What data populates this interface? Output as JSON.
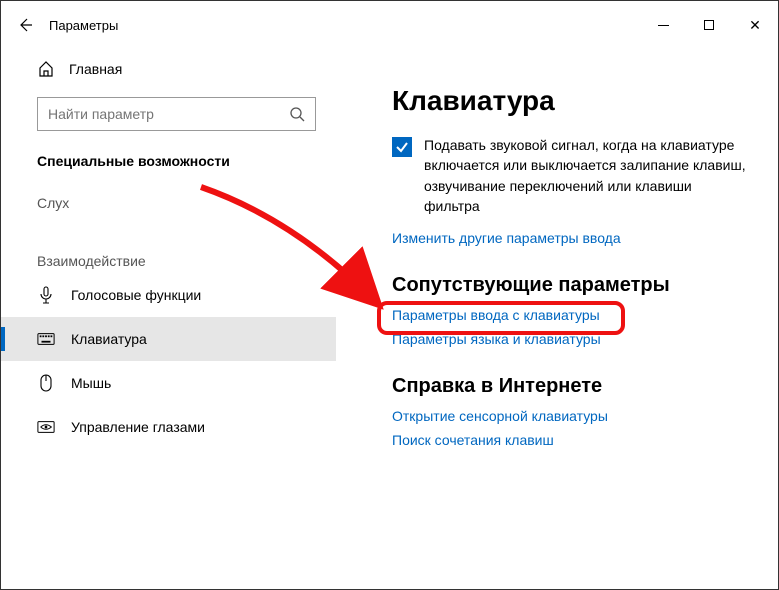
{
  "titlebar": {
    "title": "Параметры"
  },
  "sidebar": {
    "home_label": "Главная",
    "search_placeholder": "Найти параметр",
    "section_head": "Специальные возможности",
    "hearing_head": "Слух",
    "interaction_head": "Взаимодействие",
    "items": [
      {
        "label": "Голосовые функции"
      },
      {
        "label": "Клавиатура"
      },
      {
        "label": "Мышь"
      },
      {
        "label": "Управление глазами"
      }
    ]
  },
  "main": {
    "heading": "Клавиатура",
    "checkbox_text": "Подавать звуковой сигнал, когда на клавиатуре включается или выключается залипание клавиш, озвучивание переключений или клавиши фильтра",
    "link_change_input": "Изменить другие параметры ввода",
    "related_head": "Сопутствующие параметры",
    "link_kb_input": "Параметры ввода с клавиатуры",
    "link_lang_kb": "Параметры языка и клавиатуры",
    "help_head": "Справка в Интернете",
    "link_touch_kb": "Открытие сенсорной клавиатуры",
    "link_shortcuts": "Поиск сочетания клавиш"
  }
}
